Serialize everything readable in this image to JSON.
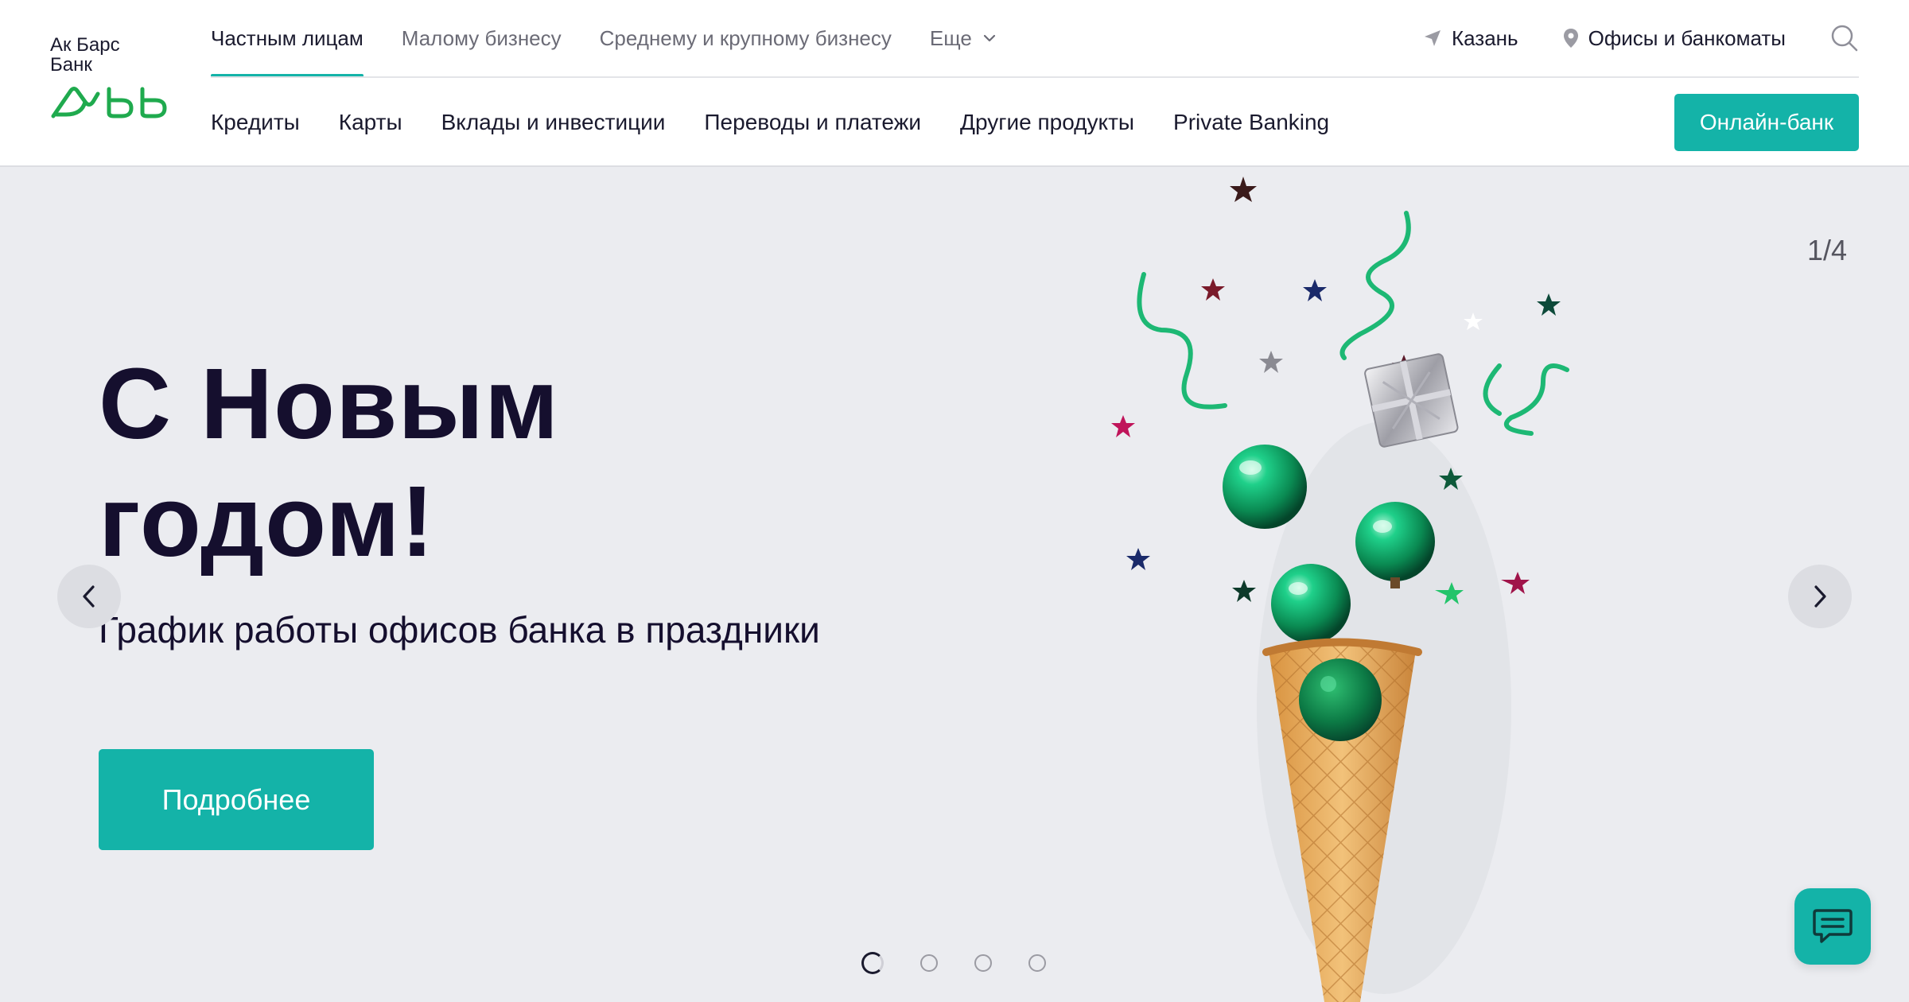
{
  "brand": {
    "line1": "Ак Барс",
    "line2": "Банк",
    "accent": "#14b3a8",
    "logo_color": "#1faa4e"
  },
  "top_nav": [
    {
      "label": "Частным лицам",
      "active": true
    },
    {
      "label": "Малому бизнесу",
      "active": false
    },
    {
      "label": "Среднему и крупному бизнесу",
      "active": false
    },
    {
      "label": "Еще",
      "active": false,
      "icon": "chevron-down-icon"
    }
  ],
  "top_right": {
    "city": "Казань",
    "city_icon": "location-arrow-icon",
    "offices": "Офисы и банкоматы",
    "offices_icon": "map-pin-icon",
    "search_icon": "search-icon"
  },
  "main_nav": [
    "Кредиты",
    "Карты",
    "Вклады и инвестиции",
    "Переводы и платежи",
    "Другие продукты",
    "Private Banking"
  ],
  "online_bank": "Онлайн-банк",
  "hero": {
    "title": "С Новым годом!",
    "subtitle": "График работы офисов банка в праздники",
    "button": "Подробнее",
    "counter": "1/4",
    "slides_total": 4,
    "active_slide": 1
  },
  "chat_icon": "chat-icon"
}
